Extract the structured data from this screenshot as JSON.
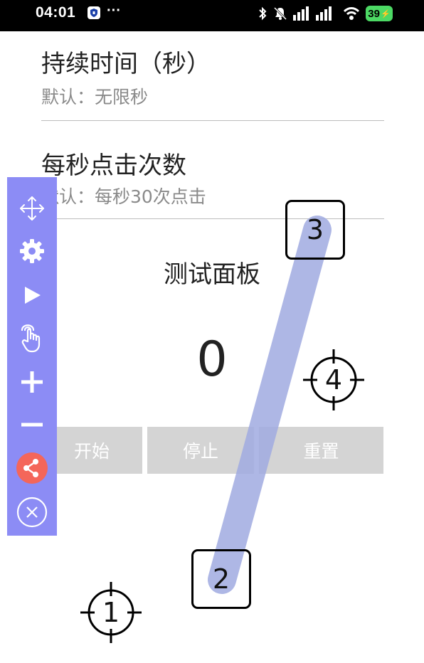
{
  "status_bar": {
    "time": "04:01",
    "more": "···",
    "battery": "39"
  },
  "settings": {
    "duration": {
      "title": "持续时间（秒）",
      "subtitle": "默认：无限秒"
    },
    "clicks_per_second": {
      "title": "每秒点击次数",
      "subtitle": "默认：每秒30次点击"
    }
  },
  "test_panel": {
    "title": "测试面板",
    "count": "0",
    "buttons": {
      "start": "开始",
      "stop": "停止",
      "reset": "重置"
    }
  },
  "toolbar": {
    "items": [
      {
        "icon": "move-icon"
      },
      {
        "icon": "gear-icon"
      },
      {
        "icon": "play-icon"
      },
      {
        "icon": "hand-tap-icon"
      },
      {
        "icon": "plus-icon"
      },
      {
        "icon": "minus-icon"
      },
      {
        "icon": "share-icon"
      },
      {
        "icon": "close-circle-icon"
      }
    ]
  },
  "targets": {
    "t1": "1",
    "t2": "2",
    "t3": "3",
    "t4": "4"
  },
  "colors": {
    "toolbar": "#8c8cf5",
    "share_button": "#f4665a",
    "swipe_path": "#a0aae0",
    "button_bg": "#d4d4d4",
    "battery": "#4cd964"
  }
}
